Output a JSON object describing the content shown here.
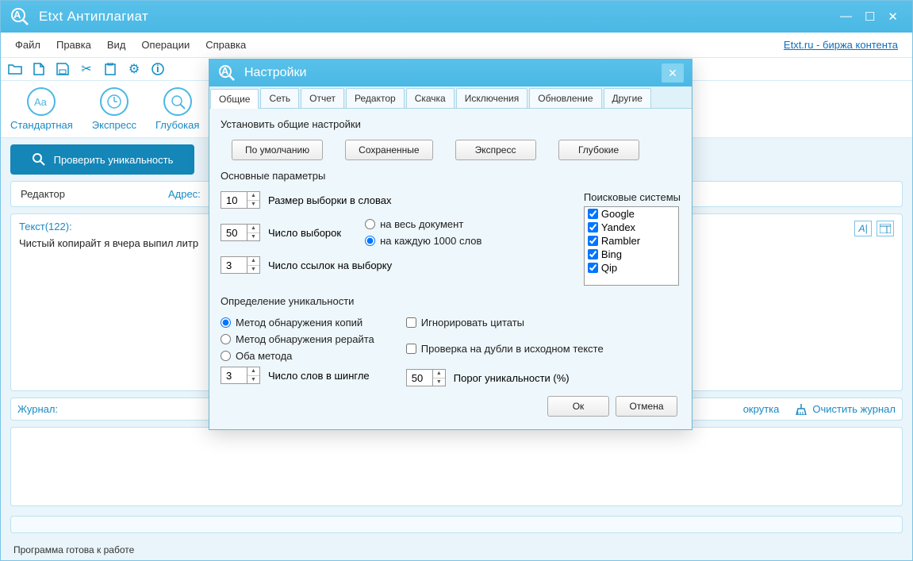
{
  "app": {
    "title": "Etxt Антиплагиат"
  },
  "menu": {
    "file": "Файл",
    "edit": "Правка",
    "view": "Вид",
    "ops": "Операции",
    "help": "Справка",
    "link": "Etxt.ru - биржа контента"
  },
  "modes": {
    "standard": "Стандартная",
    "express": "Экспресс",
    "deep": "Глубокая"
  },
  "main_button": "Проверить уникальность",
  "editor": {
    "label": "Редактор",
    "address": "Адрес:",
    "text_label": "Текст(122):",
    "text": "Чистый копирайт я вчера выпил литр"
  },
  "journal": {
    "label": "Журнал:",
    "scroll": "окрутка",
    "clear": "Очистить журнал"
  },
  "status": "Программа готова к работе",
  "dialog": {
    "title": "Настройки",
    "tabs": {
      "general": "Общие",
      "net": "Сеть",
      "report": "Отчет",
      "editor": "Редактор",
      "download": "Скачка",
      "exclude": "Исключения",
      "update": "Обновление",
      "other": "Другие"
    },
    "presets": {
      "label": "Установить общие настройки",
      "default": "По умолчанию",
      "saved": "Сохраненные",
      "express": "Экспресс",
      "deep": "Глубокие"
    },
    "params": {
      "label": "Основные параметры",
      "sample_size": {
        "value": "10",
        "label": "Размер выборки в словах"
      },
      "sample_count": {
        "value": "50",
        "label": "Число выборок"
      },
      "links_count": {
        "value": "3",
        "label": "Число ссылок на выборку"
      },
      "scope": {
        "whole": "на весь документ",
        "per1000": "на каждую 1000 слов"
      },
      "engines_label": "Поисковые системы",
      "engines": [
        "Google",
        "Yandex",
        "Rambler",
        "Bing",
        "Qip"
      ]
    },
    "uniq": {
      "label": "Определение уникальности",
      "copy": "Метод обнаружения копий",
      "rewrite": "Метод обнаружения рерайта",
      "both": "Оба метода",
      "shingle": {
        "value": "3",
        "label": "Число слов в шингле"
      },
      "ignore_quotes": "Игнорировать цитаты",
      "check_dupes": "Проверка на дубли в исходном тексте",
      "threshold": {
        "value": "50",
        "label": "Порог уникальности (%)"
      }
    },
    "buttons": {
      "ok": "Ок",
      "cancel": "Отмена"
    }
  }
}
